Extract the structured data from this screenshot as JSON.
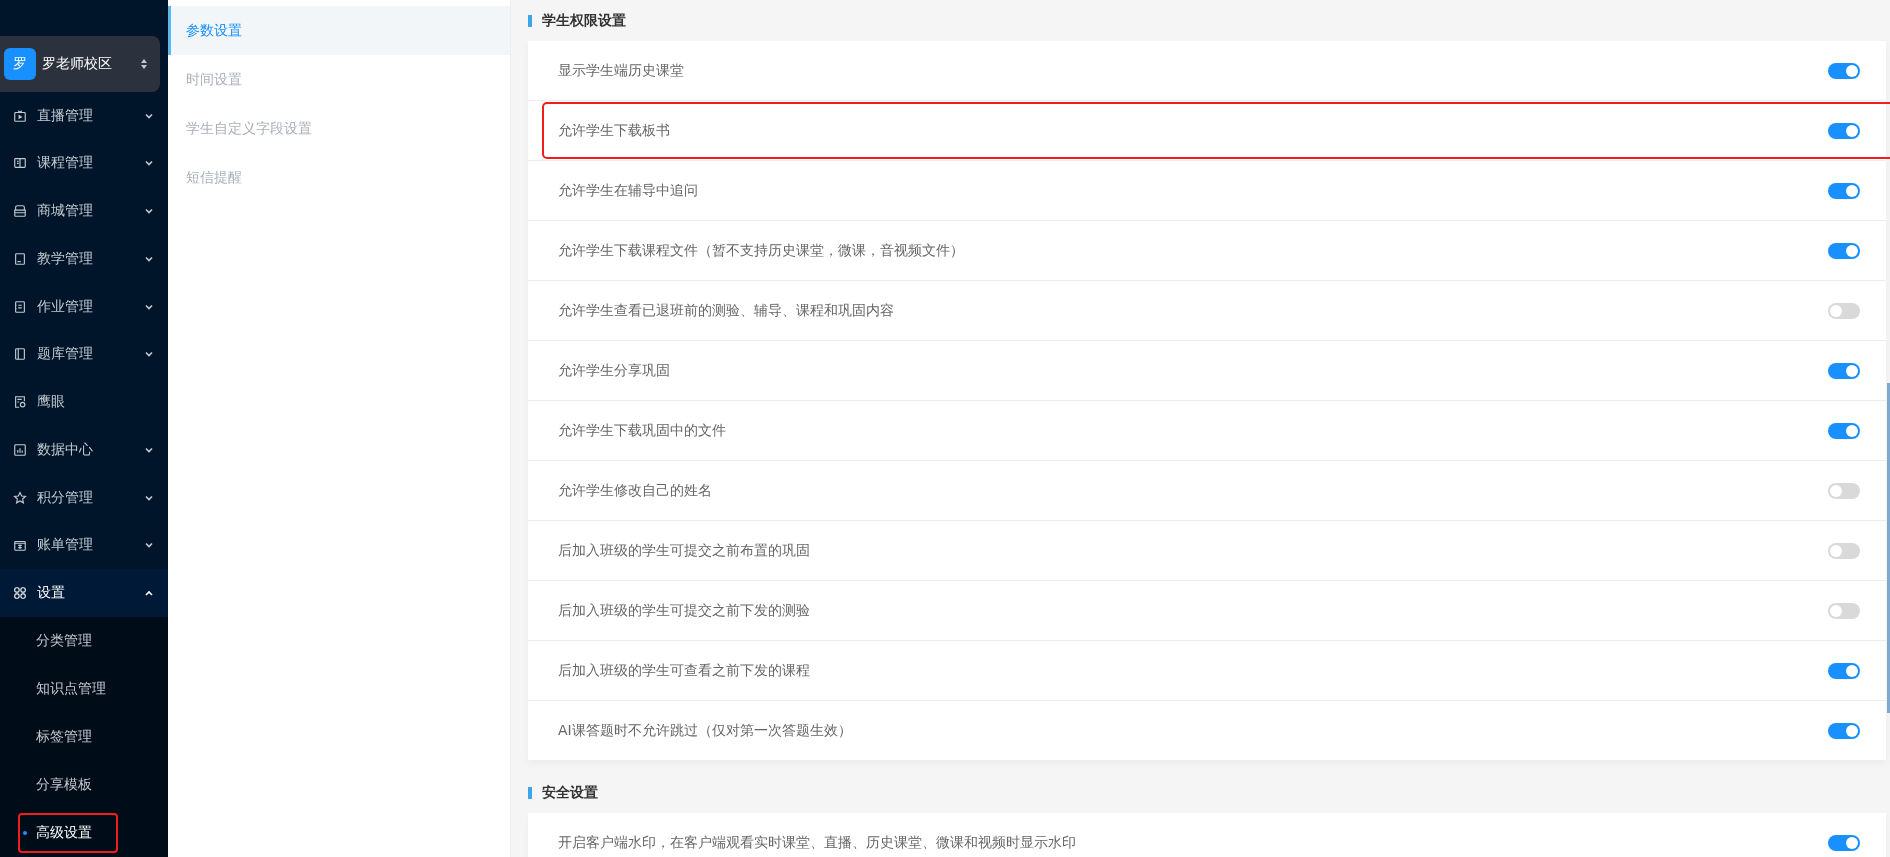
{
  "sidebar": {
    "campus": {
      "avatar": "罗",
      "name": "罗老师校区"
    },
    "items": [
      {
        "label": "直播管理",
        "expandable": true,
        "expanded": false
      },
      {
        "label": "课程管理",
        "expandable": true,
        "expanded": false
      },
      {
        "label": "商城管理",
        "expandable": true,
        "expanded": false
      },
      {
        "label": "教学管理",
        "expandable": true,
        "expanded": false
      },
      {
        "label": "作业管理",
        "expandable": true,
        "expanded": false
      },
      {
        "label": "题库管理",
        "expandable": true,
        "expanded": false
      },
      {
        "label": "鹰眼",
        "expandable": false,
        "expanded": false
      },
      {
        "label": "数据中心",
        "expandable": true,
        "expanded": false
      },
      {
        "label": "积分管理",
        "expandable": true,
        "expanded": false
      },
      {
        "label": "账单管理",
        "expandable": true,
        "expanded": false
      },
      {
        "label": "设置",
        "expandable": true,
        "expanded": true,
        "children": [
          {
            "label": "分类管理",
            "selected": false,
            "highlighted": false
          },
          {
            "label": "知识点管理",
            "selected": false,
            "highlighted": false
          },
          {
            "label": "标签管理",
            "selected": false,
            "highlighted": false
          },
          {
            "label": "分享模板",
            "selected": false,
            "highlighted": false
          },
          {
            "label": "高级设置",
            "selected": true,
            "highlighted": true
          }
        ]
      }
    ]
  },
  "subnav": [
    {
      "label": "参数设置",
      "selected": true
    },
    {
      "label": "时间设置",
      "selected": false
    },
    {
      "label": "学生自定义字段设置",
      "selected": false
    },
    {
      "label": "短信提醒",
      "selected": false
    }
  ],
  "sections": [
    {
      "title": "学生权限设置",
      "rows": [
        {
          "label": "显示学生端历史课堂",
          "on": true,
          "highlighted": false
        },
        {
          "label": "允许学生下载板书",
          "on": true,
          "highlighted": true
        },
        {
          "label": "允许学生在辅导中追问",
          "on": true,
          "highlighted": false
        },
        {
          "label": "允许学生下载课程文件（暂不支持历史课堂，微课，音视频文件）",
          "on": true,
          "highlighted": false
        },
        {
          "label": "允许学生查看已退班前的测验、辅导、课程和巩固内容",
          "on": false,
          "highlighted": false
        },
        {
          "label": "允许学生分享巩固",
          "on": true,
          "highlighted": false
        },
        {
          "label": "允许学生下载巩固中的文件",
          "on": true,
          "highlighted": false
        },
        {
          "label": "允许学生修改自己的姓名",
          "on": false,
          "highlighted": false
        },
        {
          "label": "后加入班级的学生可提交之前布置的巩固",
          "on": false,
          "highlighted": false
        },
        {
          "label": "后加入班级的学生可提交之前下发的测验",
          "on": false,
          "highlighted": false
        },
        {
          "label": "后加入班级的学生可查看之前下发的课程",
          "on": true,
          "highlighted": false
        },
        {
          "label": "AI课答题时不允许跳过（仅对第一次答题生效）",
          "on": true,
          "highlighted": false
        }
      ]
    },
    {
      "title": "安全设置",
      "rows": [
        {
          "label": "开启客户端水印，在客户端观看实时课堂、直播、历史课堂、微课和视频时显示水印",
          "on": true,
          "highlighted": false
        }
      ]
    }
  ]
}
